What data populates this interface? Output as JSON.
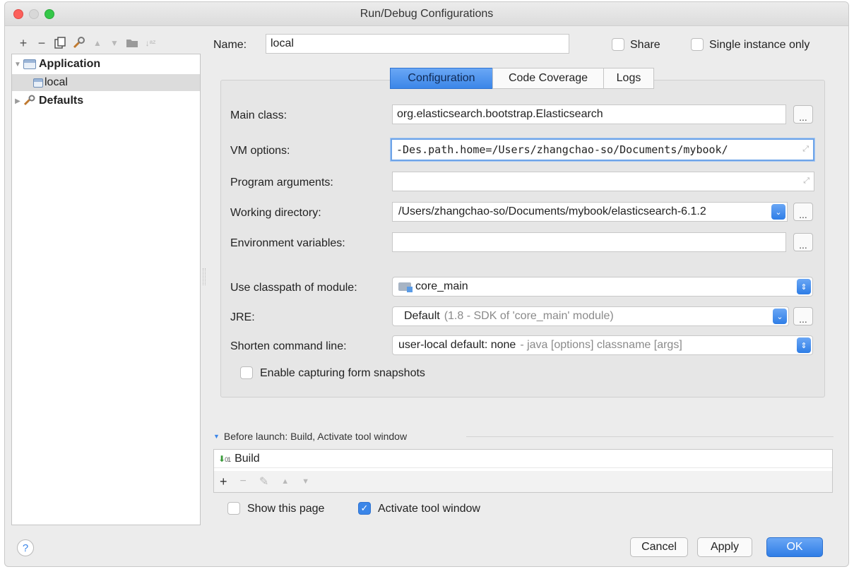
{
  "window": {
    "title": "Run/Debug Configurations"
  },
  "left_toolbar": {
    "icons": [
      "add-icon",
      "remove-icon",
      "copy-icon",
      "edit-defaults-icon",
      "move-up-icon",
      "move-down-icon",
      "folder-icon",
      "sort-icon"
    ]
  },
  "tree": {
    "items": [
      {
        "label": "Application",
        "icon": "application-icon",
        "expanded": true
      },
      {
        "label": "local",
        "icon": "application-icon",
        "selected": true
      },
      {
        "label": "Defaults",
        "icon": "wrench-icon",
        "expanded": false
      }
    ]
  },
  "name_row": {
    "label": "Name:",
    "value": "local",
    "share_label": "Share",
    "share_checked": false,
    "single_instance_label": "Single instance only",
    "single_instance_checked": false
  },
  "tabs": [
    {
      "label": "Configuration",
      "active": true
    },
    {
      "label": "Code Coverage",
      "active": false
    },
    {
      "label": "Logs",
      "active": false
    }
  ],
  "config": {
    "main_class": {
      "label": "Main class:",
      "value": "org.elasticsearch.bootstrap.Elasticsearch"
    },
    "vm_options": {
      "label": "VM options:",
      "value": "-Des.path.home=/Users/zhangchao-so/Documents/mybook/"
    },
    "program_arguments": {
      "label": "Program arguments:",
      "value": ""
    },
    "working_directory": {
      "label": "Working directory:",
      "value": "/Users/zhangchao-so/Documents/mybook/elasticsearch-6.1.2"
    },
    "environment_variables": {
      "label": "Environment variables:",
      "value": ""
    },
    "classpath_module": {
      "label": "Use classpath of module:",
      "value": "core_main"
    },
    "jre": {
      "label": "JRE:",
      "value": "Default",
      "detail": "(1.8 - SDK of 'core_main' module)"
    },
    "shorten_command_line": {
      "label": "Shorten command line:",
      "value": "user-local default: none",
      "detail": "- java [options] classname [args]"
    },
    "capture_snapshots": {
      "label": "Enable capturing form snapshots",
      "checked": false
    }
  },
  "before_launch": {
    "header": "Before launch: Build, Activate tool window",
    "tasks": [
      "Build"
    ]
  },
  "bottom_options": {
    "show_page": {
      "label": "Show this page",
      "checked": false
    },
    "activate_tool_window": {
      "label": "Activate tool window",
      "checked": true
    }
  },
  "buttons": {
    "help": "?",
    "cancel": "Cancel",
    "apply": "Apply",
    "ok": "OK"
  },
  "colors": {
    "accent": "#3b86e8",
    "window_bg": "#ececec"
  }
}
